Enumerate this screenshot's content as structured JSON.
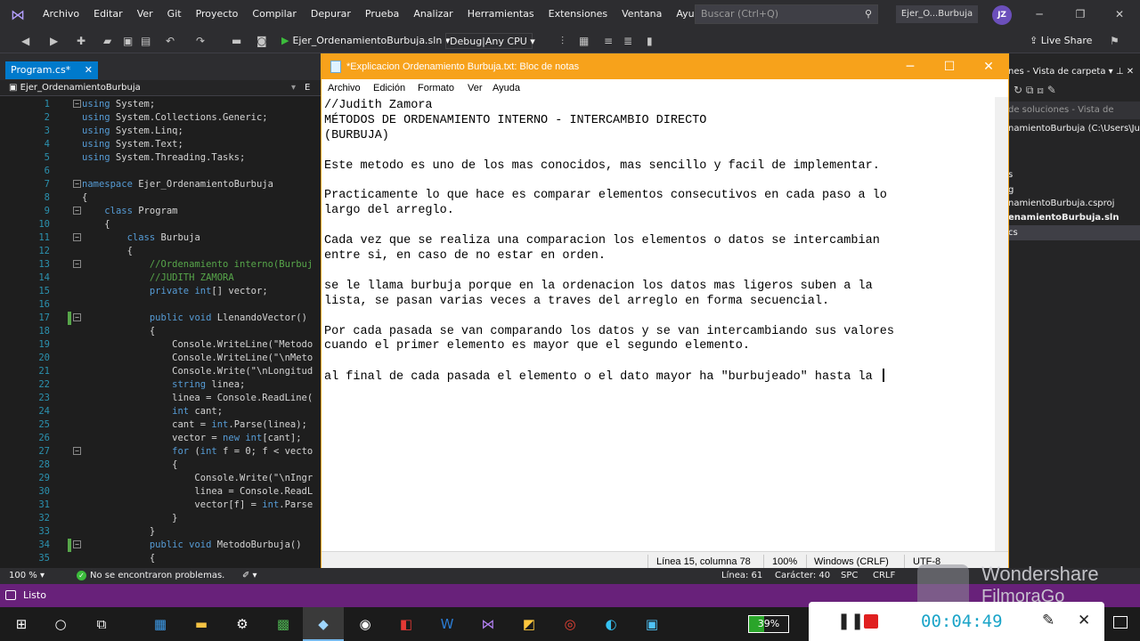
{
  "vs": {
    "menu": [
      "Archivo",
      "Editar",
      "Ver",
      "Git",
      "Proyecto",
      "Compilar",
      "Depurar",
      "Prueba",
      "Analizar",
      "Herramientas",
      "Extensiones",
      "Ventana",
      "Ayuda"
    ],
    "search_placeholder": "Buscar (Ctrl+Q)",
    "solution_name": "Ejer_O...Burbuja",
    "user_initials": "JZ",
    "run_target": "Ejer_OrdenamientoBurbuja.sln",
    "config": "Debug|Any CPU",
    "live_share": "Live Share"
  },
  "editor": {
    "tab_label": "Program.cs*",
    "nav_project": "Ejer_OrdenamientoBurbuja",
    "nav_extra": "E",
    "lines": [
      {
        "n": "1",
        "text": "using System;"
      },
      {
        "n": "2",
        "text": "using System.Collections.Generic;"
      },
      {
        "n": "3",
        "text": "using System.Linq;"
      },
      {
        "n": "4",
        "text": "using System.Text;"
      },
      {
        "n": "5",
        "text": "using System.Threading.Tasks;"
      },
      {
        "n": "6",
        "text": ""
      },
      {
        "n": "7",
        "text": "namespace Ejer_OrdenamientoBurbuja"
      },
      {
        "n": "8",
        "text": "{"
      },
      {
        "n": "9",
        "text": "    class Program"
      },
      {
        "n": "10",
        "text": "    {"
      },
      {
        "n": "11",
        "text": "        class Burbuja"
      },
      {
        "n": "12",
        "text": "        {"
      },
      {
        "n": "13",
        "text": "            //Ordenamiento interno(Burbuj"
      },
      {
        "n": "14",
        "text": "            //JUDITH ZAMORA"
      },
      {
        "n": "15",
        "text": "            private int[] vector;"
      },
      {
        "n": "16",
        "text": ""
      },
      {
        "n": "17",
        "text": "            public void LlenandoVector()"
      },
      {
        "n": "18",
        "text": "            {"
      },
      {
        "n": "19",
        "text": "                Console.WriteLine(\"Metodo"
      },
      {
        "n": "20",
        "text": "                Console.WriteLine(\"\\nMeto"
      },
      {
        "n": "21",
        "text": "                Console.Write(\"\\nLongitud"
      },
      {
        "n": "22",
        "text": "                string linea;"
      },
      {
        "n": "23",
        "text": "                linea = Console.ReadLine("
      },
      {
        "n": "24",
        "text": "                int cant;"
      },
      {
        "n": "25",
        "text": "                cant = int.Parse(linea);"
      },
      {
        "n": "26",
        "text": "                vector = new int[cant];"
      },
      {
        "n": "27",
        "text": "                for (int f = 0; f < vecto"
      },
      {
        "n": "28",
        "text": "                {"
      },
      {
        "n": "29",
        "text": "                    Console.Write(\"\\nIngr"
      },
      {
        "n": "30",
        "text": "                    linea = Console.ReadL"
      },
      {
        "n": "31",
        "text": "                    vector[f] = int.Parse"
      },
      {
        "n": "32",
        "text": "                }"
      },
      {
        "n": "33",
        "text": "            }"
      },
      {
        "n": "34",
        "text": "            public void MetodoBurbuja()"
      },
      {
        "n": "35",
        "text": "            {"
      }
    ]
  },
  "solution_explorer": {
    "header": "nes - Vista de carpeta",
    "search_placeholder": "de soluciones - Vista de",
    "items": [
      "namientoBurbuja (C:\\Users\\Judi",
      "s",
      "g",
      "namientoBurbuja.csproj",
      "enamientoBurbuja.sln",
      "cs"
    ]
  },
  "notepad": {
    "title": "*Explicacion Ordenamiento Burbuja.txt: Bloc de notas",
    "menu": [
      "Archivo",
      "Edición",
      "Formato",
      "Ver",
      "Ayuda"
    ],
    "lines": [
      "//Judith Zamora",
      "MÉTODOS DE ORDENAMIENTO INTERNO - INTERCAMBIO DIRECTO",
      "(BURBUJA)",
      "",
      "Este metodo es uno de los mas conocidos, mas sencillo y facil de implementar.",
      "",
      "Practicamente lo que hace es comparar elementos consecutivos en cada paso a lo",
      "largo del arreglo.",
      "",
      "Cada vez que se realiza una comparacion los elementos o datos se intercambian",
      "entre si, en caso de no estar en orden.",
      "",
      "se le llama burbuja porque en la ordenacion los datos mas ligeros suben a la",
      "lista, se pasan varias veces a traves del arreglo en forma secuencial.",
      "",
      "Por cada pasada se van comparando los datos y se van intercambiando sus valores",
      "cuando el primer elemento es mayor que el segundo elemento.",
      "",
      "al final de cada pasada el elemento o el dato mayor ha \"burbujeado\" hasta la "
    ],
    "status": {
      "position": "Línea 15, columna 78",
      "zoom": "100%",
      "line_ending": "Windows (CRLF)",
      "encoding": "UTF-8"
    }
  },
  "infobar": {
    "zoom": "100 %",
    "problems": "No se encontraron problemas.",
    "line": "Línea: 61",
    "char": "Carácter: 40",
    "spc": "SPC",
    "crlf": "CRLF"
  },
  "statusbar": {
    "text": "Listo"
  },
  "watermark": {
    "line1": "Wondershare",
    "line2": "FilmoraGo"
  },
  "taskbar": {
    "battery": "39%",
    "battery_level": 0.39
  },
  "recorder": {
    "time": "00:04:49"
  },
  "colors": {
    "vs_accent": "#007acc",
    "status_purple": "#68217a",
    "notepad_title": "#f7a21b"
  }
}
